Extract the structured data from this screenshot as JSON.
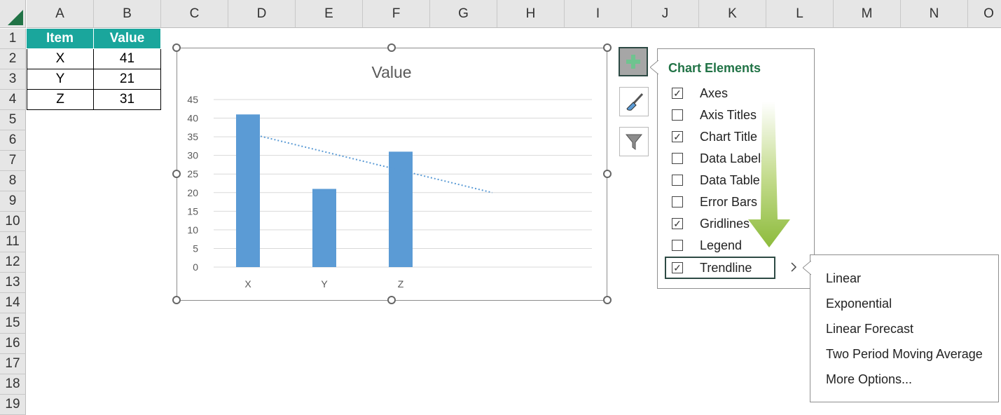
{
  "columns": [
    "A",
    "B",
    "C",
    "D",
    "E",
    "F",
    "G",
    "H",
    "I",
    "J",
    "K",
    "L",
    "M",
    "N",
    "O"
  ],
  "rows": [
    "1",
    "2",
    "3",
    "4",
    "5",
    "6",
    "7",
    "8",
    "9",
    "10",
    "11",
    "12",
    "13",
    "14",
    "15",
    "16",
    "17",
    "18",
    "19"
  ],
  "table": {
    "headers": [
      "Item",
      "Value"
    ],
    "rows": [
      [
        "X",
        "41"
      ],
      [
        "Y",
        "21"
      ],
      [
        "Z",
        "31"
      ]
    ]
  },
  "chart_data": {
    "type": "bar",
    "title": "Value",
    "categories": [
      "X",
      "Y",
      "Z"
    ],
    "values": [
      41,
      21,
      31
    ],
    "ylim": [
      0,
      45
    ],
    "yticks": [
      "0",
      "5",
      "10",
      "15",
      "20",
      "25",
      "30",
      "35",
      "40",
      "45"
    ],
    "grid": true,
    "trendline": "linear",
    "colors": {
      "bar": "#5b9bd5",
      "trend": "#5b9bd5"
    }
  },
  "chart_elements": {
    "title": "Chart Elements",
    "items": [
      {
        "label": "Axes",
        "checked": true
      },
      {
        "label": "Axis Titles",
        "checked": false
      },
      {
        "label": "Chart Title",
        "checked": true
      },
      {
        "label": "Data Labels",
        "checked": false
      },
      {
        "label": "Data Table",
        "checked": false
      },
      {
        "label": "Error Bars",
        "checked": false
      },
      {
        "label": "Gridlines",
        "checked": true
      },
      {
        "label": "Legend",
        "checked": false
      },
      {
        "label": "Trendline",
        "checked": true
      }
    ]
  },
  "trendline_menu": {
    "items": [
      "Linear",
      "Exponential",
      "Linear Forecast",
      "Two Period Moving Average",
      "More Options..."
    ]
  },
  "icons": {
    "add": "plus-icon",
    "style": "paintbrush-icon",
    "filter": "funnel-icon",
    "submenu": "chevron-right-icon"
  },
  "colors": {
    "header_teal": "#1aa69c",
    "title_green": "#217346",
    "accent_arrow": "#8dbb3c"
  }
}
